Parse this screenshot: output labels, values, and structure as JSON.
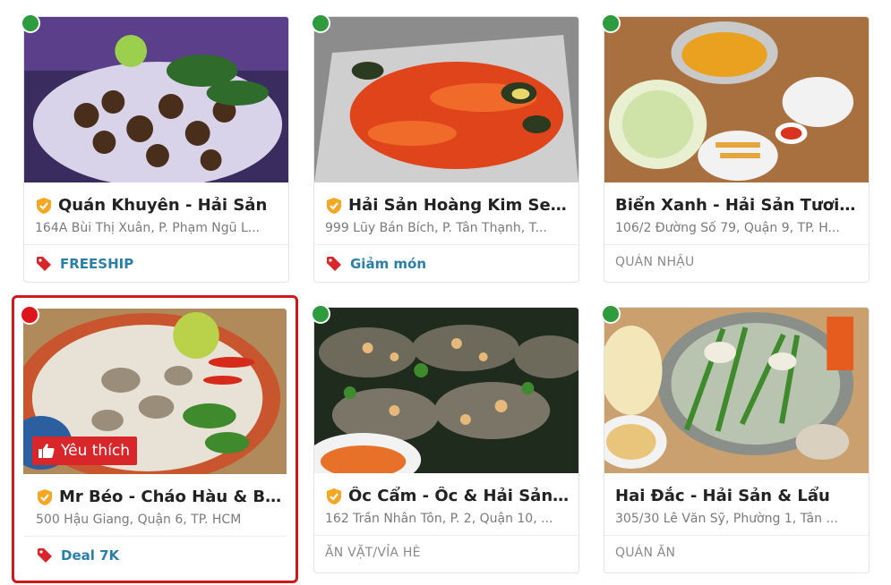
{
  "colors": {
    "open_dot": "#2e9b3f",
    "closed_dot": "#e0141b",
    "promo_text": "#2a7fa8",
    "tag_icon": "#d9262b",
    "verified_badge": "#f5a623",
    "favorite_badge": "#d9262b",
    "selected_border": "#d0171c"
  },
  "cards": [
    {
      "title": "Quán Khuyên - Hải Sản",
      "address": "164A Bùi Thị Xuân, P. Phạm Ngũ L...",
      "verified": true,
      "status": "open",
      "promo": "FREESHIP",
      "category": ""
    },
    {
      "title": "Hải Sản Hoàng Kim Seaf...",
      "address": "999 Lũy Bán Bích, P. Tân Thạnh, T...",
      "verified": true,
      "status": "open",
      "promo": "Giảm món",
      "category": ""
    },
    {
      "title": "Biển Xanh - Hải Sản Tươi S...",
      "address": "106/2 Đường Số 79, Quận 9, TP. H...",
      "verified": false,
      "status": "open",
      "promo": "",
      "category": "QUÁN NHẬU"
    },
    {
      "title": "Mr Béo - Cháo Hàu & Bột...",
      "address": "500 Hậu Giang, Quận 6, TP. HCM",
      "verified": true,
      "status": "closed",
      "promo": "Deal 7K",
      "category": "",
      "favorite_label": "Yêu thích"
    },
    {
      "title": "Ốc Cẩm - Ốc & Hải Sản - ...",
      "address": "162 Trần Nhân Tôn, P. 2, Quận 10, ...",
      "verified": true,
      "status": "open",
      "promo": "",
      "category": "ĂN VẶT/VỈA HÈ"
    },
    {
      "title": "Hai Đắc - Hải Sản & Lẩu",
      "address": "305/30 Lê Văn Sỹ, Phường 1, Tân ...",
      "verified": false,
      "status": "open",
      "promo": "",
      "category": "QUÁN ĂN"
    }
  ]
}
